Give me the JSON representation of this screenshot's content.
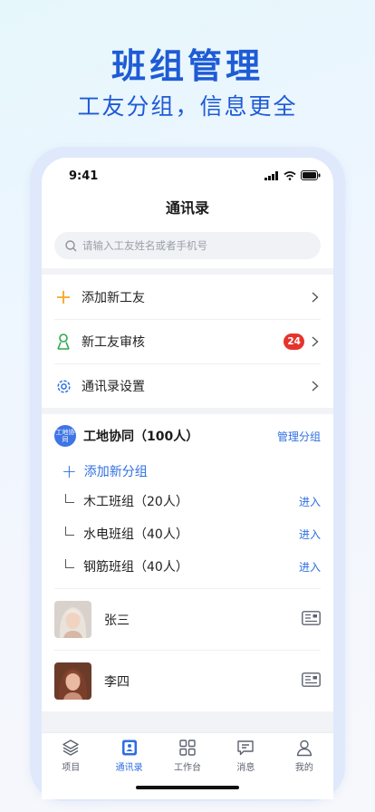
{
  "promo": {
    "title": "班组管理",
    "subtitle": "工友分组，信息更全"
  },
  "status_bar": {
    "time": "9:41"
  },
  "nav": {
    "title": "通讯录"
  },
  "search": {
    "placeholder": "请输入工友姓名或者手机号"
  },
  "menu": [
    {
      "label": "添加新工友",
      "icon": "plus-icon"
    },
    {
      "label": "新工友审核",
      "icon": "user-check-icon",
      "badge": "24"
    },
    {
      "label": "通讯录设置",
      "icon": "settings-gear-icon"
    }
  ],
  "group": {
    "avatar_text": "工地协同",
    "name": "工地协同（100人）",
    "manage_label": "管理分组",
    "add_label": "添加新分组",
    "subgroups": [
      {
        "name": "木工班组（20人）",
        "action": "进入"
      },
      {
        "name": "水电班组（40人）",
        "action": "进入"
      },
      {
        "name": "钢筋班组（40人）",
        "action": "进入"
      }
    ]
  },
  "contacts": [
    {
      "name": "张三"
    },
    {
      "name": "李四"
    }
  ],
  "tabs": [
    {
      "label": "项目",
      "icon": "layers-icon",
      "active": false
    },
    {
      "label": "通讯录",
      "icon": "contacts-book-icon",
      "active": true
    },
    {
      "label": "工作台",
      "icon": "grid-icon",
      "active": false
    },
    {
      "label": "消息",
      "icon": "message-icon",
      "active": false
    },
    {
      "label": "我的",
      "icon": "profile-icon",
      "active": false
    }
  ],
  "colors": {
    "accent": "#2f6fe0",
    "promo_title": "#1e5bd6",
    "badge": "#e5342c",
    "add_icon": "#f5a623",
    "review_icon": "#2fa84f"
  }
}
